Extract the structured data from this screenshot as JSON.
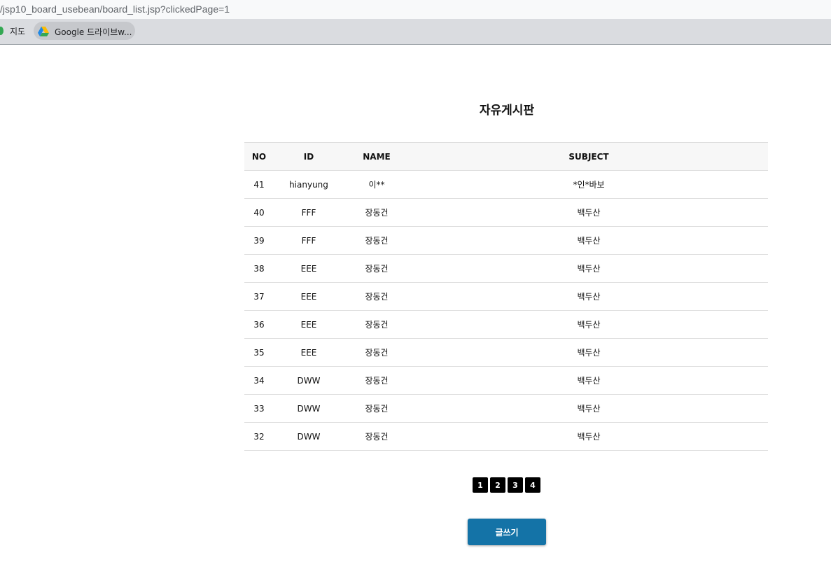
{
  "browser": {
    "url": "/jsp10_board_usebean/board_list.jsp?clickedPage=1",
    "bookmarks": [
      {
        "label": "지도"
      },
      {
        "label": "Google 드라이브w..."
      }
    ]
  },
  "board": {
    "title": "자유게시판",
    "columns": [
      "NO",
      "ID",
      "NAME",
      "SUBJECT"
    ],
    "rows": [
      {
        "no": "41",
        "id": "hianyung",
        "name": "이**",
        "subject": "*인*바보"
      },
      {
        "no": "40",
        "id": "FFF",
        "name": "장동건",
        "subject": "백두산"
      },
      {
        "no": "39",
        "id": "FFF",
        "name": "장동건",
        "subject": "백두산"
      },
      {
        "no": "38",
        "id": "EEE",
        "name": "장동건",
        "subject": "백두산"
      },
      {
        "no": "37",
        "id": "EEE",
        "name": "장동건",
        "subject": "백두산"
      },
      {
        "no": "36",
        "id": "EEE",
        "name": "장동건",
        "subject": "백두산"
      },
      {
        "no": "35",
        "id": "EEE",
        "name": "장동건",
        "subject": "백두산"
      },
      {
        "no": "34",
        "id": "DWW",
        "name": "장동건",
        "subject": "백두산"
      },
      {
        "no": "33",
        "id": "DWW",
        "name": "장동건",
        "subject": "백두산"
      },
      {
        "no": "32",
        "id": "DWW",
        "name": "장동건",
        "subject": "백두산"
      }
    ],
    "pages": [
      "1",
      "2",
      "3",
      "4"
    ],
    "write_label": "글쓰기"
  },
  "colors": {
    "button": "#1473a7",
    "pager": "#000000",
    "header_bg": "#f7f7f7"
  }
}
